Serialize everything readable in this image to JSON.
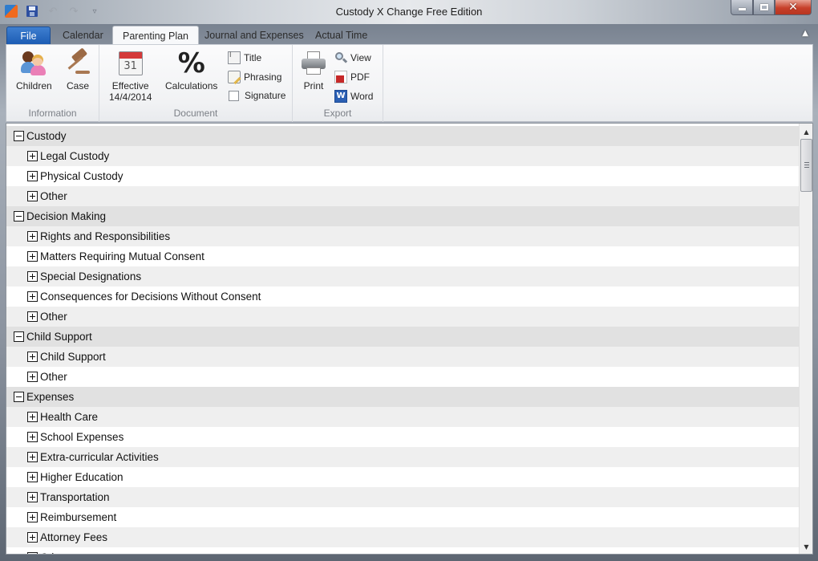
{
  "window": {
    "title": "Custody X Change Free Edition",
    "quick_access": [
      "app-logo",
      "save",
      "undo",
      "redo",
      "customize"
    ]
  },
  "tabs": [
    {
      "label": "File",
      "active": false
    },
    {
      "label": "Calendar",
      "active": false
    },
    {
      "label": "Parenting Plan",
      "active": true
    },
    {
      "label": "Journal and Expenses",
      "active": false
    },
    {
      "label": "Actual Time",
      "active": false
    }
  ],
  "ribbon": {
    "groups": {
      "information": {
        "label": "Information",
        "children_label": "Children",
        "case_label": "Case"
      },
      "document": {
        "label": "Document",
        "effective_label": "Effective",
        "effective_date": "14/4/2014",
        "calendar_day": "31",
        "calculations_label": "Calculations",
        "title_label": "Title",
        "phrasing_label": "Phrasing",
        "signature_label": "Signature"
      },
      "export": {
        "label": "Export",
        "print_label": "Print",
        "view_label": "View",
        "pdf_label": "PDF",
        "word_label": "Word",
        "word_glyph": "W"
      }
    }
  },
  "tree": {
    "groups": [
      {
        "label": "Custody",
        "expanded": true,
        "children": [
          "Legal Custody",
          "Physical Custody",
          "Other"
        ]
      },
      {
        "label": "Decision Making",
        "expanded": true,
        "children": [
          "Rights and Responsibilities",
          "Matters Requiring Mutual Consent",
          "Special Designations",
          "Consequences for Decisions Without Consent",
          "Other"
        ]
      },
      {
        "label": "Child Support",
        "expanded": true,
        "children": [
          "Child Support",
          "Other"
        ]
      },
      {
        "label": "Expenses",
        "expanded": true,
        "children": [
          "Health Care",
          "School Expenses",
          "Extra-curricular Activities",
          "Higher Education",
          "Transportation",
          "Reimbursement",
          "Attorney Fees",
          "Other"
        ]
      }
    ]
  },
  "colors": {
    "file_tab": "#1c5cb4",
    "group_row": "#e1e1e1",
    "child_row_alt": "#efefef",
    "close_button": "#c7402a"
  }
}
